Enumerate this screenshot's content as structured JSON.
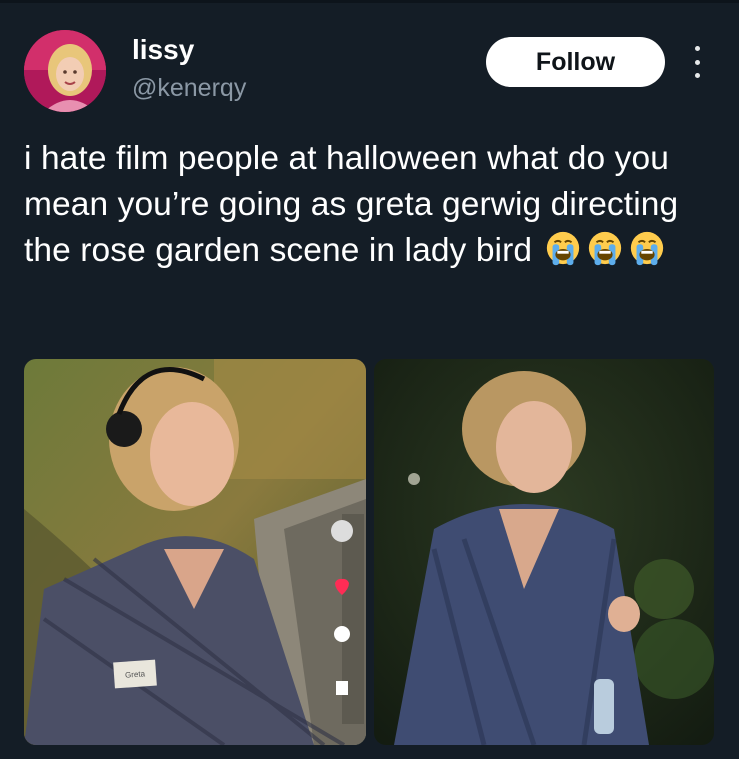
{
  "user": {
    "name": "lissy",
    "handle": "@kenerqy"
  },
  "actions": {
    "follow_label": "Follow",
    "more_icon": "more-vertical-icon"
  },
  "tweet": {
    "text": "i hate film people at halloween what do you mean you’re going as greta gerwig directing the rose garden scene in lady bird",
    "emoji": [
      "loudly-crying-face",
      "loudly-crying-face",
      "loudly-crying-face"
    ]
  },
  "media": {
    "left_photo_tag": "Greta",
    "count": 2
  },
  "colors": {
    "background": "#141d26",
    "secondary_text": "#8b98a5",
    "follow_bg": "#ffffff"
  }
}
